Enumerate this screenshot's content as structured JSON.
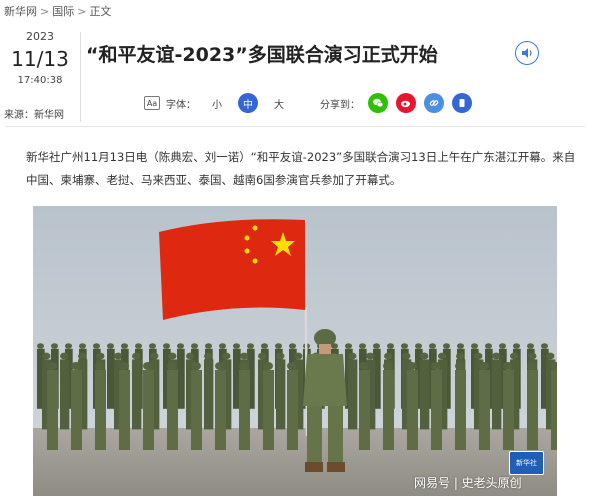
{
  "breadcrumb": {
    "items": [
      "新华网",
      "国际",
      "正文"
    ],
    "separator": ">"
  },
  "date": {
    "year": "2023",
    "month_day": "11/13",
    "time": "17:40:38"
  },
  "source": "来源：新华网",
  "article": {
    "title": "“和平友谊-2023”多国联合演习正式开始",
    "paragraph": "新华社广州11月13日电（陈典宏、刘一诺）“和平友谊-2023”多国联合演习13日上午在广东湛江开幕。来自中国、柬埔寨、老挝、马来西亚、泰国、越南6国参演官兵参加了开幕式。"
  },
  "font_size": {
    "label": "字体：",
    "options": [
      "小",
      "中",
      "大"
    ],
    "selected": "中",
    "icon_text": "Aa"
  },
  "share": {
    "label": "分享到：",
    "icons": [
      "wechat-icon",
      "weibo-icon",
      "link-icon",
      "mobile-icon"
    ],
    "colors": [
      "#2dc100",
      "#e6162d",
      "#4a90e2",
      "#3367d6"
    ]
  },
  "photo": {
    "watermark_badge": "新华社",
    "watermark_text": "网易号 | 史老头原创"
  },
  "colors": {
    "accent": "#3367d6",
    "flag_red": "#de2910",
    "flag_star": "#ffde00"
  }
}
